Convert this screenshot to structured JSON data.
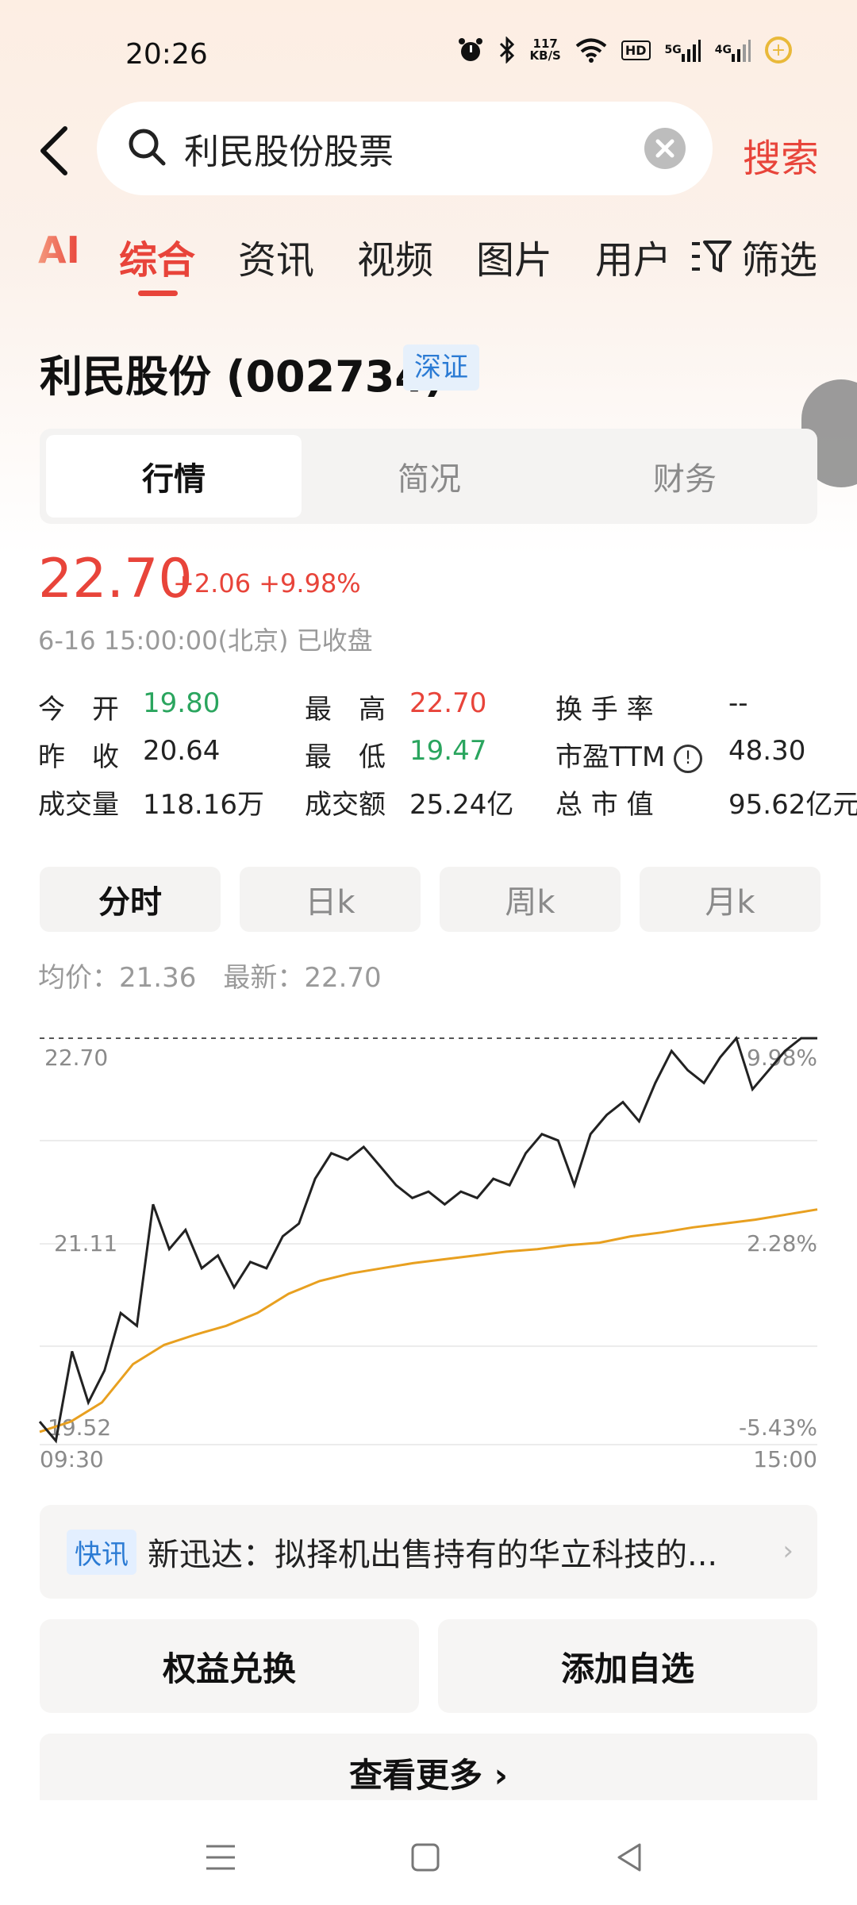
{
  "status_bar": {
    "time": "20:26",
    "net_speed_value": "117",
    "net_speed_unit": "KB/S",
    "hd_label": "HD",
    "signal1": "5G",
    "signal2": "4G"
  },
  "search": {
    "query": "利民股份股票",
    "button_label": "搜索"
  },
  "tabs": {
    "ai": "AI",
    "items": [
      "综合",
      "资讯",
      "视频",
      "图片",
      "用户"
    ],
    "active": "综合",
    "filter_label": "筛选"
  },
  "stock": {
    "title": "利民股份 (002734)",
    "exchange": "深证",
    "segments": [
      "行情",
      "简况",
      "财务"
    ],
    "active_segment": "行情",
    "price": "22.70",
    "change": "+2.06 +9.98%",
    "date": "6-16 15:00:00(北京) 已收盘",
    "stats": {
      "open_label": "今　开",
      "open": "19.80",
      "high_label": "最　高",
      "high": "22.70",
      "turnover_label": "换 手 率",
      "turnover": "--",
      "prev_close_label": "昨　收",
      "prev_close": "20.64",
      "low_label": "最　低",
      "low": "19.47",
      "pe_label": "市盈TTM",
      "pe": "48.30",
      "volume_label": "成交量",
      "volume": "118.16万",
      "amount_label": "成交额",
      "amount": "25.24亿",
      "mcap_label": "总 市 值",
      "mcap": "95.62亿元"
    }
  },
  "period_tabs": [
    "分时",
    "日k",
    "周k",
    "月k"
  ],
  "active_period": "分时",
  "avg_line": "均价：21.36　最新：22.70",
  "chart_data": {
    "type": "line",
    "y_left_ticks": [
      "22.70",
      "21.11",
      "19.52"
    ],
    "y_right_ticks": [
      "9.98%",
      "2.28%",
      "-5.43%"
    ],
    "x_ticks": [
      "09:30",
      "15:00"
    ],
    "ylim": [
      19.52,
      22.7
    ],
    "series": [
      {
        "color": "#222222",
        "values": [
          19.7,
          19.55,
          20.25,
          19.85,
          20.1,
          20.55,
          20.45,
          21.4,
          21.05,
          21.2,
          20.9,
          21.0,
          20.75,
          20.95,
          20.9,
          21.15,
          21.25,
          21.6,
          21.8,
          21.75,
          21.85,
          21.7,
          21.55,
          21.45,
          21.5,
          21.4,
          21.5,
          21.45,
          21.6,
          21.55,
          21.8,
          21.95,
          21.9,
          21.55,
          21.95,
          22.1,
          22.2,
          22.05,
          22.35,
          22.6,
          22.45,
          22.35,
          22.55,
          22.7,
          22.3,
          22.45,
          22.6,
          22.7,
          22.7
        ]
      },
      {
        "color": "#e8a020",
        "values": [
          19.62,
          19.7,
          19.85,
          20.15,
          20.3,
          20.38,
          20.45,
          20.55,
          20.7,
          20.8,
          20.86,
          20.9,
          20.94,
          20.97,
          21.0,
          21.03,
          21.05,
          21.08,
          21.1,
          21.15,
          21.18,
          21.22,
          21.25,
          21.28,
          21.32,
          21.36
        ]
      }
    ]
  },
  "news": {
    "badge": "快讯",
    "text": "新迅达：拟择机出售持有的华立科技的..."
  },
  "actions": {
    "equity_exchange": "权益兑换",
    "add_watchlist": "添加自选",
    "see_more": "查看更多 ›"
  },
  "icons": {
    "back": "back-arrow-icon",
    "search": "search-icon",
    "clear": "clear-icon",
    "filter": "filter-icon",
    "info": "info-icon"
  },
  "colors": {
    "accent_red": "#e8443a",
    "up_green": "#2aa55e",
    "avg_line": "#e8a020",
    "exchange_blue": "#2b7bd4"
  }
}
